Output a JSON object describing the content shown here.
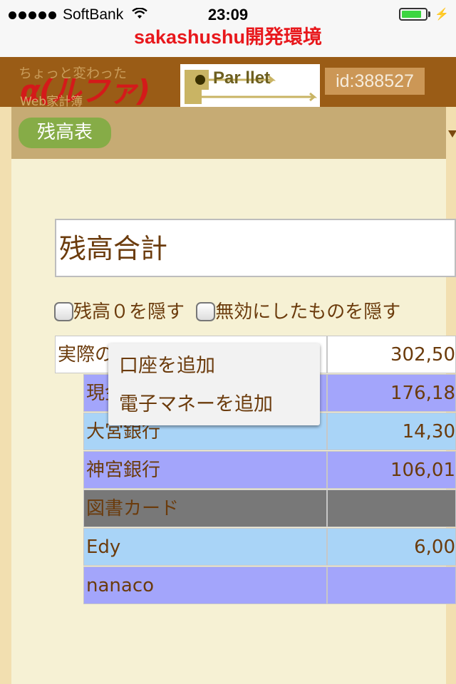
{
  "status_bar": {
    "carrier": "SoftBank",
    "time": "23:09",
    "battery_level": 0.85,
    "charging_icon": "⚡"
  },
  "app_title": "sakashushu開発環境",
  "header": {
    "logo_line1": "ちょっと変わった",
    "logo_line2": "Web家計簿",
    "logo_big": "α(ルファ)版",
    "parllet_logo": "Par llet",
    "user_id": "id:388527"
  },
  "nav": {
    "balance_tab": "残高表"
  },
  "main": {
    "total_title": "残高合計",
    "hide_zero_label": "残高０を隠す",
    "hide_disabled_label": "無効にしたものを隠す"
  },
  "table": {
    "rows": [
      {
        "name": "実際の",
        "value": "302,50",
        "bg": "#ffffff"
      },
      {
        "name": "現金",
        "value": "176,18",
        "bg": "#a3a5fb"
      },
      {
        "name": "大宮銀行",
        "value": "14,30",
        "bg": "#a9d4f7"
      },
      {
        "name": "神宮銀行",
        "value": "106,01",
        "bg": "#a3a5fb"
      },
      {
        "name": "図書カード",
        "value": "",
        "bg": "#787878"
      },
      {
        "name": "Edy",
        "value": "6,00",
        "bg": "#a9d4f7"
      },
      {
        "name": "nanaco",
        "value": "",
        "bg": "#a3a5fb"
      }
    ]
  },
  "context_menu": {
    "items": [
      "口座を追加",
      "電子マネーを追加"
    ]
  },
  "colors": {
    "title_red": "#e8181c",
    "header_brown": "#9a5c16",
    "tab_green": "#86ac47",
    "text_brown": "#6b3b0c"
  }
}
